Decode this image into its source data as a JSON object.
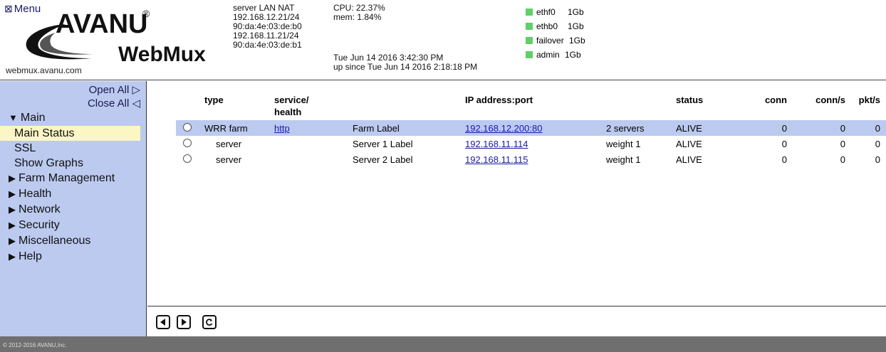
{
  "header": {
    "menu_label": "Menu",
    "logo_text_top": "AVANU",
    "logo_reg": "®",
    "logo_text_bottom": "WebMux",
    "site_url": "webmux.avanu.com",
    "net": [
      "server LAN NAT",
      "192.168.12.21/24",
      "90:da:4e:03:de:b0",
      "192.168.11.21/24",
      "90:da:4e:03:de:b1"
    ],
    "cpu": "CPU: 22.37%",
    "mem": "mem: 1.84%",
    "datetime": "Tue Jun 14 2016 3:42:30 PM",
    "uptime": "up since Tue Jun 14 2016 2:18:18 PM",
    "interfaces": [
      {
        "name": "ethf0",
        "speed": "1Gb"
      },
      {
        "name": "ethb0",
        "speed": "1Gb"
      },
      {
        "name": "failover",
        "speed": "1Gb"
      },
      {
        "name": "admin",
        "speed": "1Gb"
      }
    ],
    "led_color": "#5fd068"
  },
  "sidebar": {
    "open_all": "Open All ▷",
    "close_all": "Close All ◁",
    "main_label": "Main",
    "main_items": [
      "Main Status",
      "SSL",
      "Show Graphs"
    ],
    "sections": [
      "Farm Management",
      "Health",
      "Network",
      "Security",
      "Miscellaneous",
      "Help"
    ]
  },
  "table": {
    "headers": {
      "type": "type",
      "service_health_1": "service/",
      "service_health_2": "health",
      "ip_port": "IP address:port",
      "status": "status",
      "conn": "conn",
      "conn_s": "conn/s",
      "pkt_s": "pkt/s"
    },
    "rows": [
      {
        "type": "WRR farm",
        "service": "http",
        "label": "Farm Label",
        "ip": "192.168.12.200:80",
        "info": "2 servers",
        "status": "ALIVE",
        "conn": "0",
        "conn_s": "0",
        "pkt_s": "0"
      },
      {
        "type": "server",
        "service": "",
        "label": "Server 1 Label",
        "ip": "192.168.11.114",
        "info": "weight 1",
        "status": "ALIVE",
        "conn": "0",
        "conn_s": "0",
        "pkt_s": "0"
      },
      {
        "type": "server",
        "service": "",
        "label": "Server 2 Label",
        "ip": "192.168.11.115",
        "info": "weight 1",
        "status": "ALIVE",
        "conn": "0",
        "conn_s": "0",
        "pkt_s": "0"
      }
    ]
  },
  "footer": {
    "copyright": "© 2012-2016 AVANU,Inc."
  },
  "colors": {
    "sidebar_bg": "#bccaf0",
    "active_item_bg": "#fbf6c4",
    "selected_row_bg": "#bccaf0",
    "link": "#1a1aa6",
    "footer_bg": "#6f6f6f"
  }
}
